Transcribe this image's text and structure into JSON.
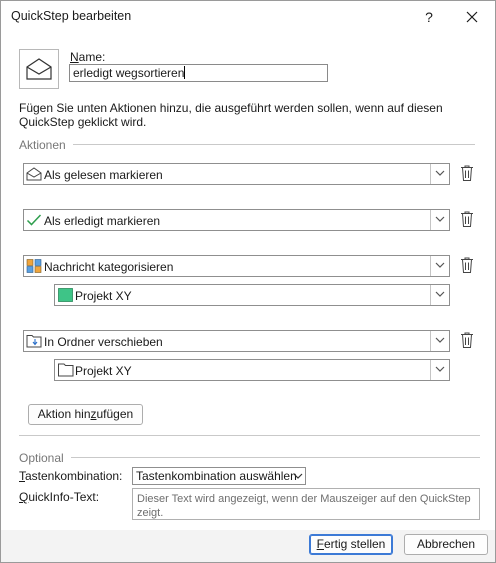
{
  "window": {
    "title": "QuickStep bearbeiten",
    "help_label": "?"
  },
  "name": {
    "label": "Name:",
    "value": "erledigt wegsortieren"
  },
  "description": "Fügen Sie unten Aktionen hinzu, die ausgeführt werden sollen, wenn auf diesen QuickStep geklickt wird.",
  "actions_section": {
    "title": "Aktionen",
    "actions": [
      {
        "label": "Als gelesen markieren",
        "icon": "open-envelope-icon"
      },
      {
        "label": "Als erledigt markieren",
        "icon": "checkmark-icon"
      },
      {
        "label": "Nachricht kategorisieren",
        "icon": "categorize-icon",
        "option": {
          "label": "Projekt XY",
          "icon": "category-color-icon",
          "color": "#3ec487"
        }
      },
      {
        "label": "In Ordner verschieben",
        "icon": "move-to-folder-icon",
        "option": {
          "label": "Projekt XY",
          "icon": "folder-icon"
        }
      }
    ],
    "add_button": "Aktion hinzufügen"
  },
  "optional_section": {
    "title": "Optional",
    "shortcut_label": "Tastenkombination:",
    "shortcut_value": "Tastenkombination auswählen",
    "tooltip_label": "QuickInfo-Text:",
    "tooltip_placeholder": "Dieser Text wird angezeigt, wenn der Mauszeiger auf den QuickStep zeigt."
  },
  "footer": {
    "finish_button": "Fertig stellen",
    "cancel_button": "Abbrechen"
  },
  "colors": {
    "accent": "#3c7ad6",
    "check_green": "#2e9e4d",
    "category_green": "#3ec487"
  }
}
